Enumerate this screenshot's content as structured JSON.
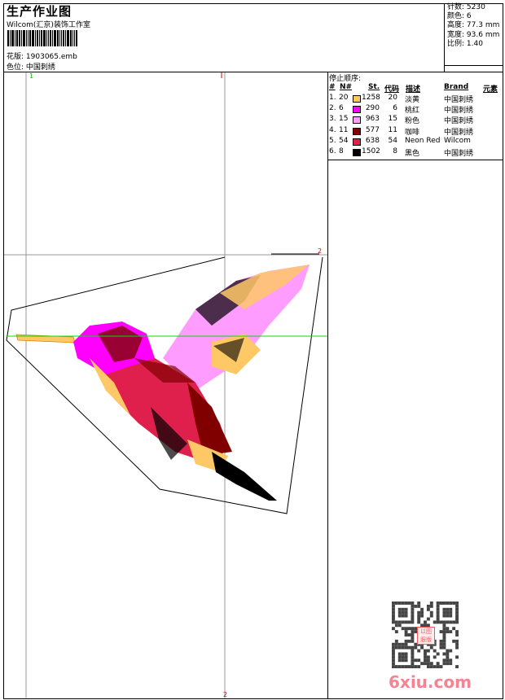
{
  "header": {
    "title": "生产作业图",
    "company": "Wilcom(汇京)装饰工作室",
    "file_label": "花版:",
    "file": "1903065.emb",
    "colorpos_label": "色位:",
    "colorpos": "中国刺绣"
  },
  "stats": [
    {
      "label": "针数:",
      "value": "5230"
    },
    {
      "label": "颜色:",
      "value": "6"
    },
    {
      "label": "高度:",
      "value": "77.3 mm"
    },
    {
      "label": "宽度:",
      "value": "93.6 mm"
    },
    {
      "label": "比例:",
      "value": "1.40"
    }
  ],
  "stop_sequence": {
    "title": "停止顺序:",
    "headers": [
      "#",
      "N#",
      "St.",
      "代码",
      "描述",
      "Brand",
      "元素"
    ],
    "rows": [
      {
        "idx": "1.",
        "n": "20",
        "color": "#FFC866",
        "st": "1258",
        "code": "20",
        "desc": "淡黄",
        "brand": "中国刺绣"
      },
      {
        "idx": "2.",
        "n": "6",
        "color": "#FF00FF",
        "st": "290",
        "code": "6",
        "desc": "桃红",
        "brand": "中国刺绣"
      },
      {
        "idx": "3.",
        "n": "15",
        "color": "#FF9CFF",
        "st": "963",
        "code": "15",
        "desc": "粉色",
        "brand": "中国刺绣"
      },
      {
        "idx": "4.",
        "n": "11",
        "color": "#800000",
        "st": "577",
        "code": "11",
        "desc": "咖啡",
        "brand": "中国刺绣"
      },
      {
        "idx": "5.",
        "n": "54",
        "color": "#E0204C",
        "st": "638",
        "code": "54",
        "desc": "Neon Red",
        "brand": "Wilcom"
      },
      {
        "idx": "6.",
        "n": "8",
        "color": "#000000",
        "st": "1502",
        "code": "8",
        "desc": "黑色",
        "brand": "中国刺绣"
      }
    ]
  },
  "canvas": {
    "marker_top": "1",
    "marker_right": "2",
    "marker_bottom": "2"
  },
  "watermark": {
    "text": "6xiu.com",
    "stamp": "以图服版"
  }
}
